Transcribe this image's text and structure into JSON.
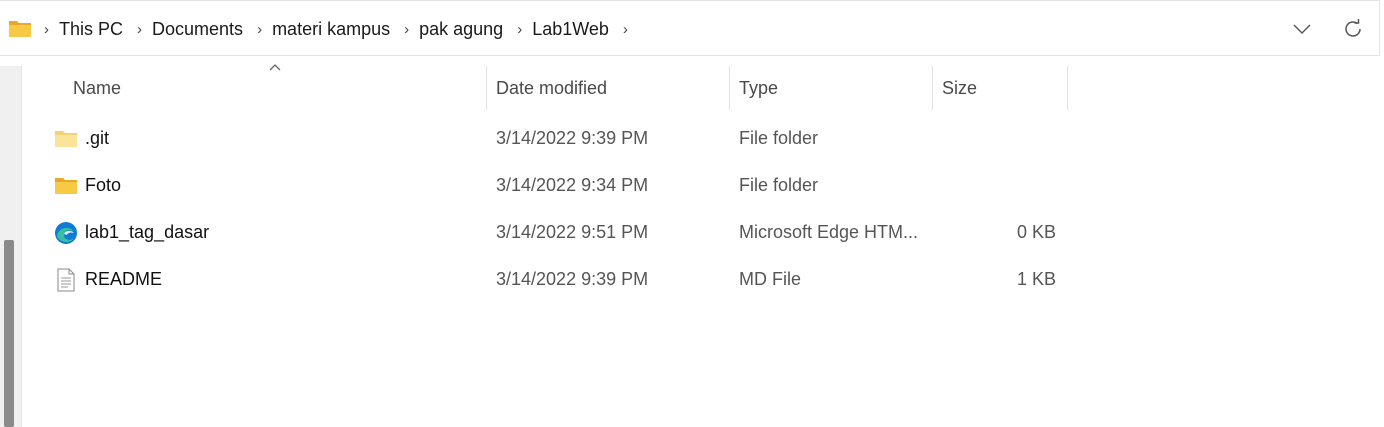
{
  "breadcrumb": [
    "This PC",
    "Documents",
    "materi kampus",
    "pak agung",
    "Lab1Web"
  ],
  "columns": {
    "name": "Name",
    "date_modified": "Date modified",
    "type": "Type",
    "size": "Size"
  },
  "files": [
    {
      "name": ".git",
      "date": "3/14/2022 9:39 PM",
      "type": "File folder",
      "size": "",
      "icon": "folder-light-icon"
    },
    {
      "name": "Foto",
      "date": "3/14/2022 9:34 PM",
      "type": "File folder",
      "size": "",
      "icon": "folder-icon"
    },
    {
      "name": "lab1_tag_dasar",
      "date": "3/14/2022 9:51 PM",
      "type": "Microsoft Edge HTM...",
      "size": "0 KB",
      "icon": "edge-icon"
    },
    {
      "name": "README",
      "date": "3/14/2022 9:39 PM",
      "type": "MD File",
      "size": "1 KB",
      "icon": "document-icon"
    }
  ],
  "colors": {
    "folder": "#f8c944",
    "folder_light": "#fbe39a",
    "edge_blue": "#0f7bd6",
    "edge_green": "#36c0a0"
  }
}
